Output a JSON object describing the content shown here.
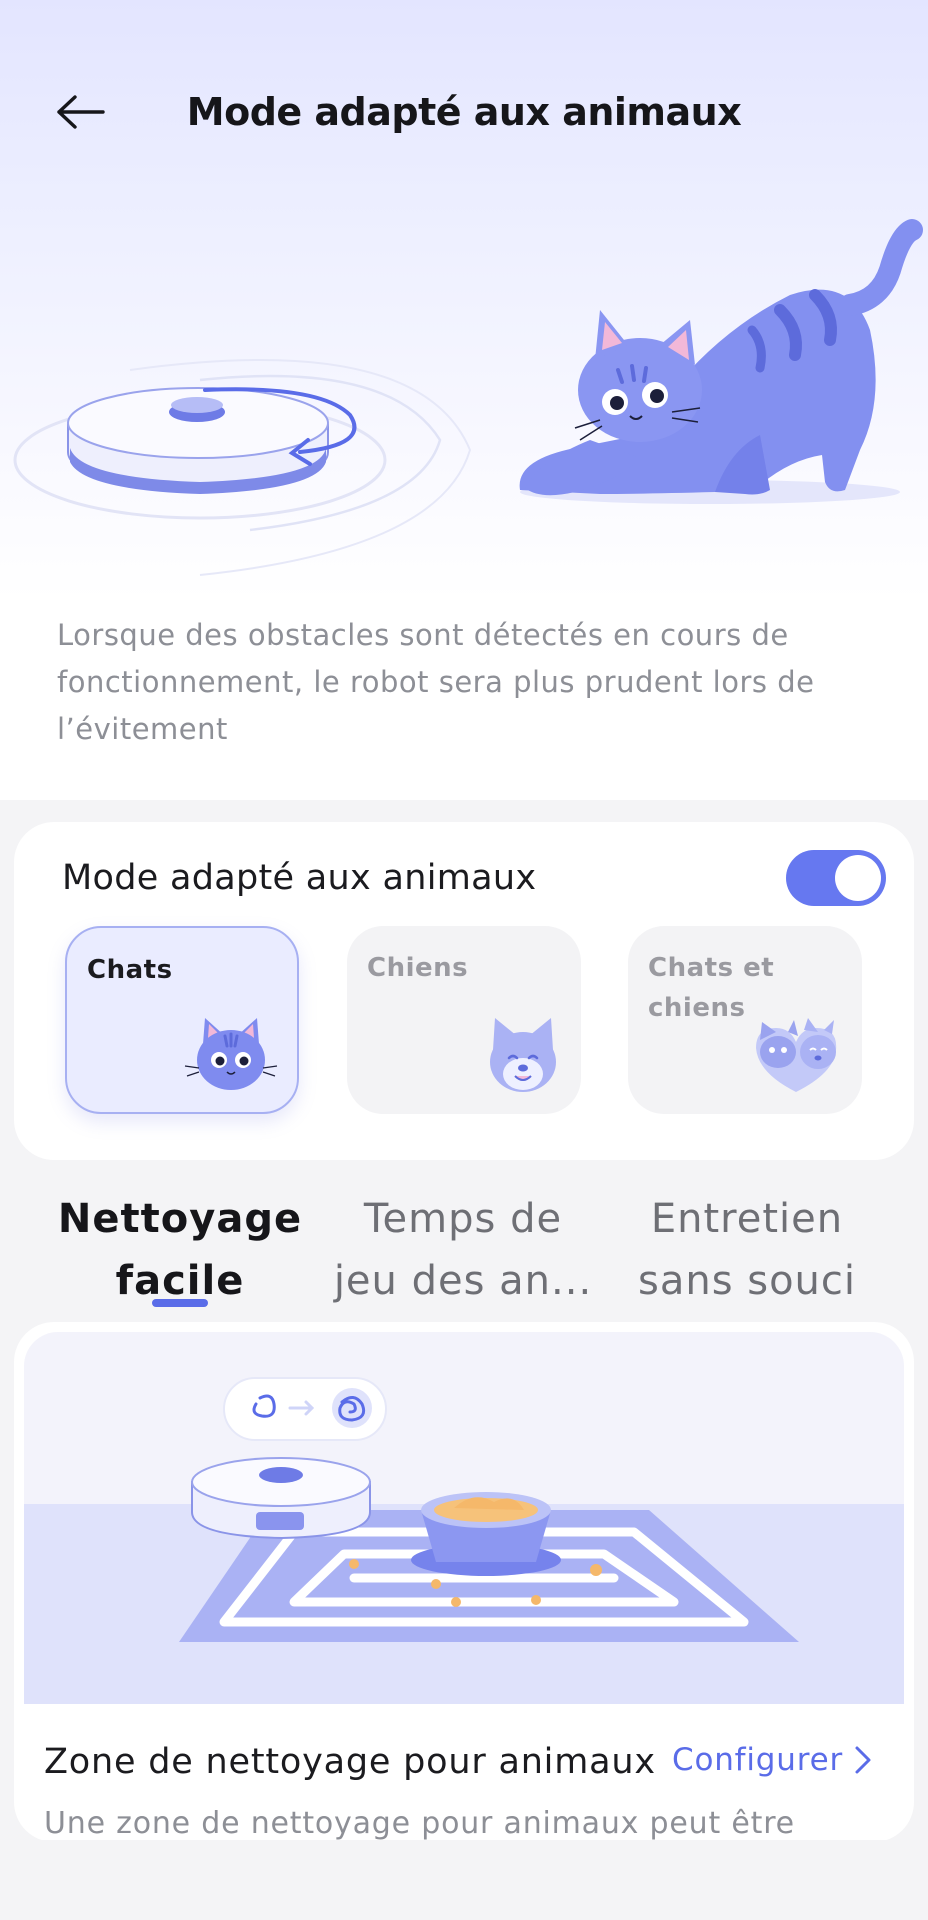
{
  "header": {
    "back_icon": "arrow-left-icon",
    "title": "Mode adapté aux animaux"
  },
  "description": "Lorsque des obstacles sont détectés en cours de fonctionnement, le robot sera plus prudent lors de l’évitement",
  "pet_mode": {
    "label": "Mode adapté aux animaux",
    "enabled": true,
    "options": [
      {
        "label": "Chats",
        "selected": true,
        "icon": "cat-face-icon"
      },
      {
        "label": "Chiens",
        "selected": false,
        "icon": "dog-face-icon"
      },
      {
        "label": "Chats et chiens",
        "selected": false,
        "icon": "cat-and-dog-icon"
      }
    ]
  },
  "tabs": [
    {
      "label": "Nettoyage facile",
      "active": true
    },
    {
      "label": "Temps de jeu des an...",
      "active": false
    },
    {
      "label": "Entretien sans souci",
      "active": false
    }
  ],
  "feature": {
    "title": "Zone de nettoyage pour animaux",
    "action": "Configurer",
    "action_icon": "chevron-right-icon",
    "description": "Une zone de nettoyage pour animaux peut être"
  },
  "colors": {
    "accent": "#5a6ce8",
    "toggle_on": "#6678f0",
    "illustration_purple": "#8390f0"
  }
}
